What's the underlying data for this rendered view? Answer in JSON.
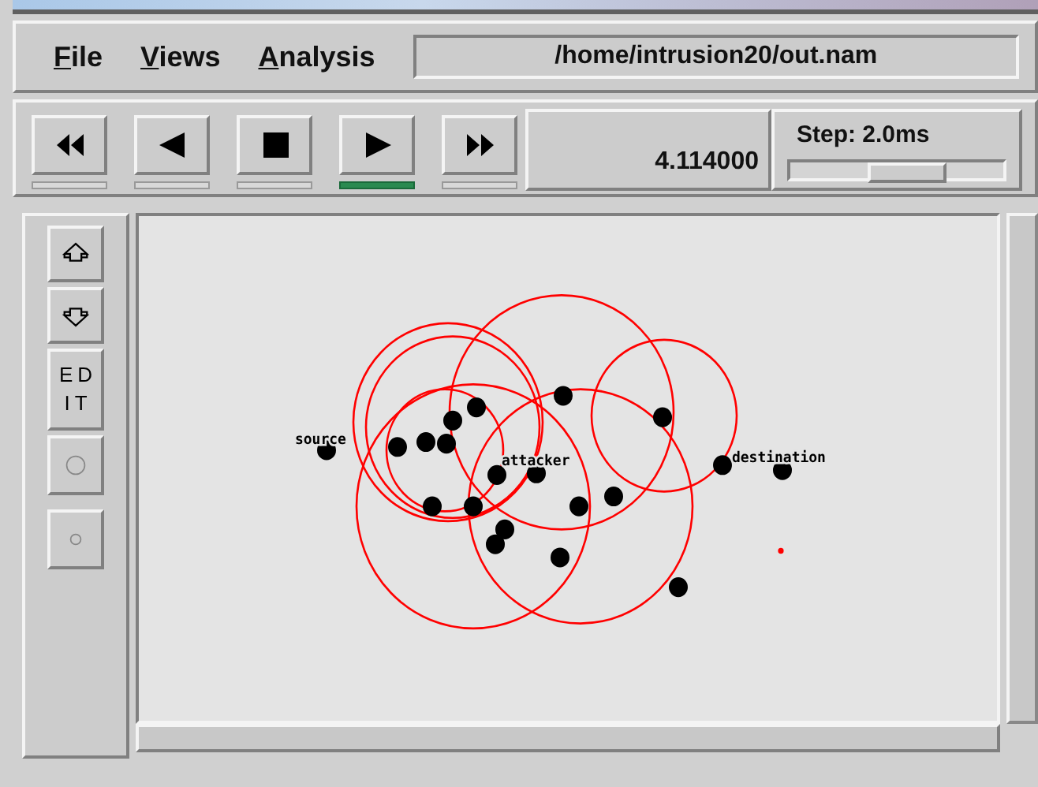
{
  "menu": [
    {
      "label": "File"
    },
    {
      "label": "Views"
    },
    {
      "label": "Analysis"
    }
  ],
  "file_path": "/home/intrusion20/out.nam",
  "playback_buttons": [
    {
      "kind": "rewind",
      "selected": false
    },
    {
      "kind": "back",
      "selected": false
    },
    {
      "kind": "stop",
      "selected": false
    },
    {
      "kind": "play",
      "selected": true
    },
    {
      "kind": "forward",
      "selected": false
    }
  ],
  "time": "4.114000",
  "step": {
    "label": "Step: 2.0ms",
    "level": 0.55
  },
  "tools": [
    {
      "kind": "zoom-in"
    },
    {
      "kind": "zoom-out"
    },
    {
      "kind": "edit",
      "label": "ED IT"
    },
    {
      "kind": "big-circle"
    },
    {
      "kind": "small-circle"
    }
  ],
  "canvas": {
    "labels": [
      {
        "kind": "source",
        "text": "source"
      },
      {
        "kind": "attacker",
        "text": "attacker"
      },
      {
        "kind": "destination",
        "text": "destination"
      }
    ]
  }
}
